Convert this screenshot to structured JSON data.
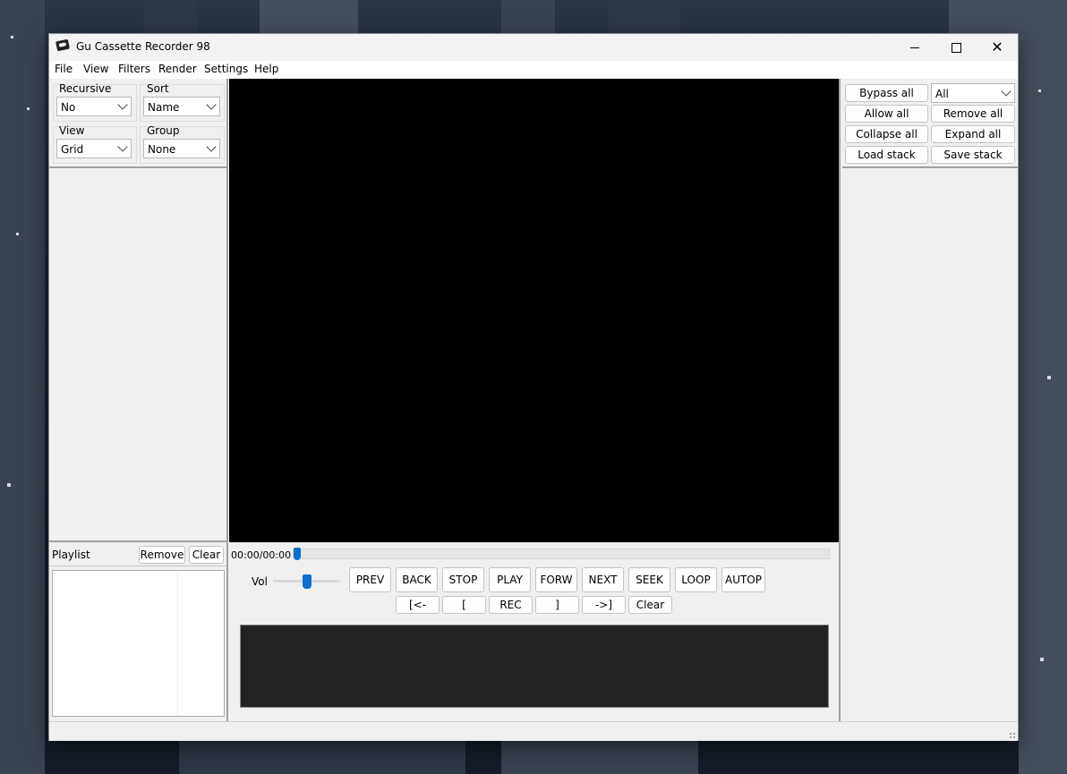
{
  "window": {
    "title": "Gu Cassette Recorder 98"
  },
  "menu": [
    "File",
    "View",
    "Filters",
    "Render",
    "Settings",
    "Help"
  ],
  "browser": {
    "recursive": {
      "label": "Recursive",
      "value": "No"
    },
    "sort": {
      "label": "Sort",
      "value": "Name"
    },
    "view": {
      "label": "View",
      "value": "Grid"
    },
    "group": {
      "label": "Group",
      "value": "None"
    }
  },
  "playlist": {
    "label": "Playlist",
    "remove": "Remove",
    "clear": "Clear"
  },
  "player": {
    "time": "00:00/00:00",
    "progress": 0,
    "vol_label": "Vol",
    "volume": 0.5,
    "transport": [
      "PREV",
      "BACK",
      "STOP",
      "PLAY",
      "FORW",
      "NEXT",
      "SEEK",
      "LOOP",
      "AUTOP"
    ],
    "markers": [
      "[<-",
      "[",
      "REC",
      "]",
      "->]",
      "Clear"
    ]
  },
  "filters": {
    "bypass_all": "Bypass all",
    "scope": "All",
    "allow_all": "Allow all",
    "remove_all": "Remove all",
    "collapse_all": "Collapse all",
    "expand_all": "Expand all",
    "load_stack": "Load stack",
    "save_stack": "Save stack"
  },
  "colors": {
    "accent": "#0a6fd1",
    "video_bg": "#000000",
    "console_bg": "#222222"
  }
}
